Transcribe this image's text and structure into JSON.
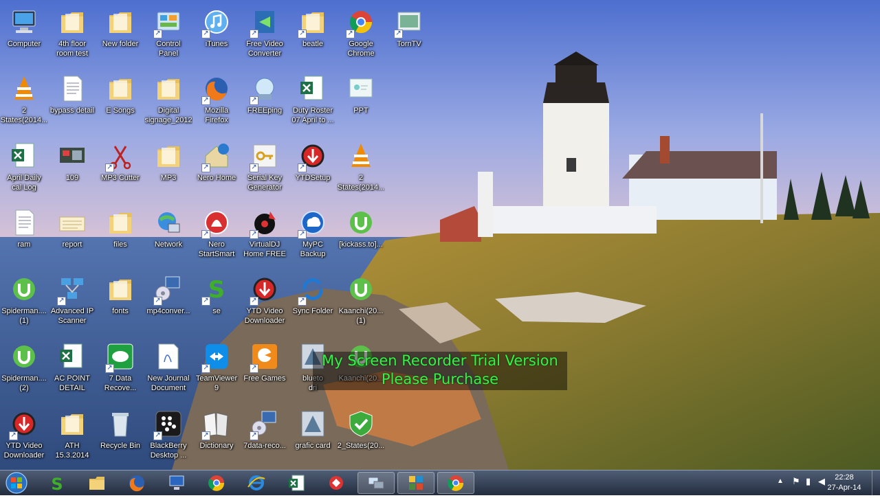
{
  "desktop": {
    "icons": [
      {
        "label": "Computer",
        "icon": "computer-icon"
      },
      {
        "label": "4th floor\nroom test",
        "icon": "folder-icon"
      },
      {
        "label": "New folder",
        "icon": "folder-icon"
      },
      {
        "label": "Control\nPanel",
        "icon": "control-panel-icon"
      },
      {
        "label": "iTunes",
        "icon": "itunes-icon"
      },
      {
        "label": "Free Video\nConverter",
        "icon": "video-converter-icon"
      },
      {
        "label": "beatle",
        "icon": "folder-icon"
      },
      {
        "label": "Google\nChrome",
        "icon": "chrome-icon"
      },
      {
        "label": "TornTV",
        "icon": "torntv-icon"
      },
      {
        "label": "2\nStates(2014...",
        "icon": "vlc-icon"
      },
      {
        "label": "bypass detail",
        "icon": "document-icon"
      },
      {
        "label": "E Songs",
        "icon": "folder-icon"
      },
      {
        "label": "Digital\nsignage_2012",
        "icon": "folder-icon"
      },
      {
        "label": "Mozilla\nFirefox",
        "icon": "firefox-icon"
      },
      {
        "label": "FREEping",
        "icon": "freeping-icon"
      },
      {
        "label": "Duty Roster\n07 April to ...",
        "icon": "excel-icon"
      },
      {
        "label": "PPT",
        "icon": "ppt-icon"
      },
      {
        "label": "April Daily\ncal Log",
        "icon": "excel-icon"
      },
      {
        "label": "109",
        "icon": "image-icon"
      },
      {
        "label": "MP3 Cutter",
        "icon": "scissors-icon"
      },
      {
        "label": "MP3",
        "icon": "folder-icon"
      },
      {
        "label": "Nero Home",
        "icon": "nero-home-icon"
      },
      {
        "label": "Serial Key\nGenerator",
        "icon": "key-icon"
      },
      {
        "label": "YTDSetup",
        "icon": "ytd-icon"
      },
      {
        "label": "2\nStates(2014...",
        "icon": "vlc-icon"
      },
      {
        "label": "ram",
        "icon": "document-icon"
      },
      {
        "label": "report",
        "icon": "report-icon"
      },
      {
        "label": "files",
        "icon": "folder-icon"
      },
      {
        "label": "Network",
        "icon": "network-icon"
      },
      {
        "label": "Nero\nStartSmart",
        "icon": "nero-icon"
      },
      {
        "label": "VirtualDJ\nHome FREE",
        "icon": "virtualdj-icon"
      },
      {
        "label": "MyPC\nBackup",
        "icon": "backup-icon"
      },
      {
        "label": "[kickass.to]...",
        "icon": "utorrent-icon"
      },
      {
        "label": "Spiderman....\n(1)",
        "icon": "utorrent-icon"
      },
      {
        "label": "Advanced IP\nScanner",
        "icon": "network-scanner-icon"
      },
      {
        "label": "fonts",
        "icon": "folder-icon"
      },
      {
        "label": "mp4conver...",
        "icon": "converter-icon"
      },
      {
        "label": "se",
        "icon": "s-icon"
      },
      {
        "label": "YTD Video\nDownloader",
        "icon": "ytd-icon"
      },
      {
        "label": "Sync Folder",
        "icon": "sync-icon"
      },
      {
        "label": "Kaanchi(20...\n(1)",
        "icon": "utorrent-icon"
      },
      {
        "label": "Spiderman....\n(2)",
        "icon": "utorrent-icon"
      },
      {
        "label": "AC POINT\nDETAIL",
        "icon": "excel-icon"
      },
      {
        "label": "7 Data\nRecove...",
        "icon": "data-recovery-icon"
      },
      {
        "label": "New Journal\nDocument",
        "icon": "journal-icon"
      },
      {
        "label": "TeamViewer\n9",
        "icon": "teamviewer-icon"
      },
      {
        "label": "Free Games",
        "icon": "games-icon"
      },
      {
        "label": "blueto\ndri",
        "icon": "driver-icon"
      },
      {
        "label": "Kaanchi(20...",
        "icon": "utorrent-icon"
      },
      {
        "label": "YTD Video\nDownloader",
        "icon": "ytd-icon"
      },
      {
        "label": "ATH\n15.3.2014",
        "icon": "folder-icon"
      },
      {
        "label": "Recycle Bin",
        "icon": "recycle-bin-icon"
      },
      {
        "label": "BlackBerry\nDesktop ...",
        "icon": "blackberry-icon"
      },
      {
        "label": "Dictionary",
        "icon": "dictionary-icon"
      },
      {
        "label": "7data-reco...",
        "icon": "converter-icon"
      },
      {
        "label": "grafic card",
        "icon": "driver-icon"
      },
      {
        "label": "2_States(20...",
        "icon": "shield-check-icon"
      }
    ]
  },
  "watermark": {
    "line1": "My Screen Recorder Trial Version",
    "line2": "Please Purchase"
  },
  "taskbar": {
    "items": [
      {
        "name": "start-button",
        "icon": "windows-orb-icon"
      },
      {
        "name": "taskbar-s",
        "icon": "s-icon"
      },
      {
        "name": "taskbar-explorer",
        "icon": "explorer-icon"
      },
      {
        "name": "taskbar-firefox",
        "icon": "firefox-icon"
      },
      {
        "name": "taskbar-remote",
        "icon": "remote-desktop-icon"
      },
      {
        "name": "taskbar-chrome",
        "icon": "chrome-icon"
      },
      {
        "name": "taskbar-ie",
        "icon": "ie-icon"
      },
      {
        "name": "taskbar-excel",
        "icon": "excel-icon"
      },
      {
        "name": "taskbar-app",
        "icon": "app-icon"
      },
      {
        "name": "taskbar-network",
        "icon": "network-icon"
      },
      {
        "name": "taskbar-switcher",
        "icon": "switcher-icon"
      },
      {
        "name": "taskbar-chrome-active",
        "icon": "chrome-icon"
      }
    ],
    "clock": {
      "time": "22:28",
      "date": "27-Apr-14"
    }
  }
}
